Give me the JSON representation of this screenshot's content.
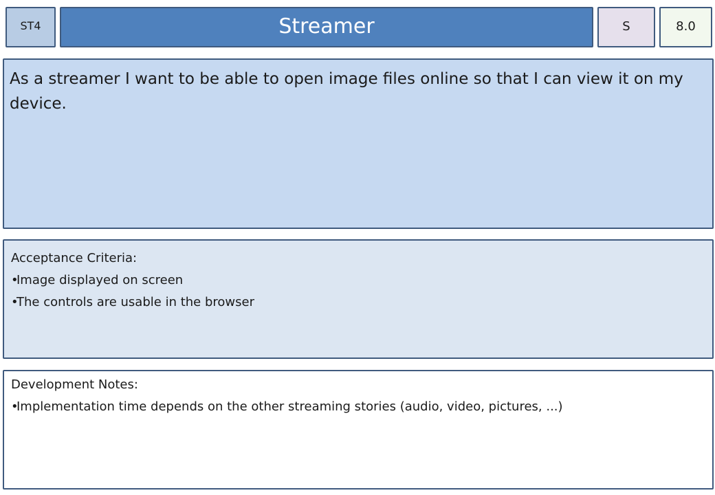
{
  "card": {
    "id": "ST4",
    "title": "Streamer",
    "size": "S",
    "points": "8.0"
  },
  "story": {
    "text": "As a streamer I want to be able to open image files online so that I can view it on my device."
  },
  "acceptance": {
    "heading": "Acceptance Criteria:",
    "items": [
      "Image displayed on screen",
      "The controls are usable in the browser"
    ]
  },
  "notes": {
    "heading": "Development Notes:",
    "items": [
      "Implementation time depends on the other streaming stories (audio, video, pictures,  ...)"
    ]
  },
  "colors": {
    "title_bg": "#4f81bd",
    "id_bg": "#b8cce4",
    "size_bg": "#e6e0ec",
    "points_bg": "#f2f8ee",
    "story_bg": "#c6d9f1",
    "criteria_bg": "#dce6f2",
    "border": "#3f5a7e"
  }
}
